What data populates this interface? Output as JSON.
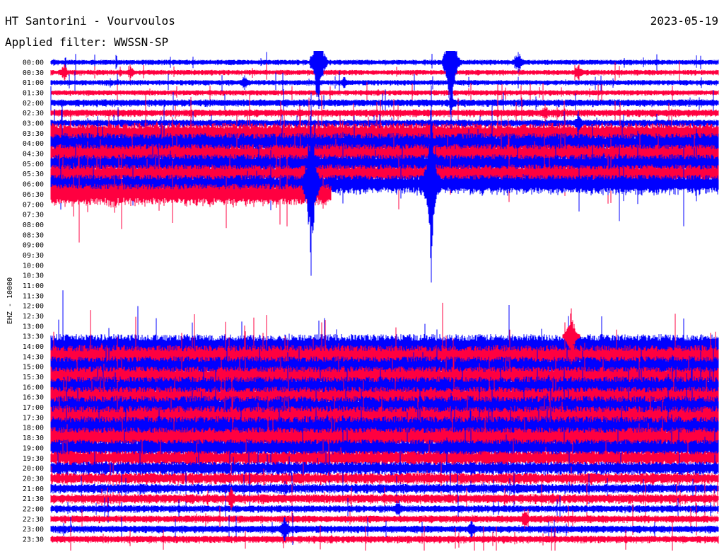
{
  "header": {
    "station": "HT Santorini - Vourvoulos",
    "date": "2023-05-19",
    "filter": "Applied filter: WWSSN-SP"
  },
  "chart_data": {
    "type": "helicorder",
    "ylabel": "EHZ - 10000",
    "trace_colors": [
      "#0000ff",
      "#ff0040"
    ],
    "rows": [
      {
        "time": "00:00",
        "level": 2,
        "gap_from": null
      },
      {
        "time": "00:30",
        "level": 2,
        "gap_from": null
      },
      {
        "time": "01:00",
        "level": 2,
        "gap_from": null
      },
      {
        "time": "01:30",
        "level": 2,
        "gap_from": null
      },
      {
        "time": "02:00",
        "level": 3,
        "gap_from": null
      },
      {
        "time": "02:30",
        "level": 3,
        "gap_from": null
      },
      {
        "time": "03:00",
        "level": 3,
        "gap_from": null
      },
      {
        "time": "03:30",
        "level": 10,
        "gap_from": null
      },
      {
        "time": "04:00",
        "level": 10,
        "gap_from": null
      },
      {
        "time": "04:30",
        "level": 9,
        "gap_from": null
      },
      {
        "time": "05:00",
        "level": 9,
        "gap_from": null
      },
      {
        "time": "05:30",
        "level": 9,
        "gap_from": null
      },
      {
        "time": "06:00",
        "level": 9,
        "gap_from": null
      },
      {
        "time": "06:30",
        "level": 10,
        "gap_from": 0.42
      },
      {
        "time": "07:00",
        "level": 0,
        "gap_from": 0
      },
      {
        "time": "07:30",
        "level": 0,
        "gap_from": 0
      },
      {
        "time": "08:00",
        "level": 0,
        "gap_from": 0
      },
      {
        "time": "08:30",
        "level": 0,
        "gap_from": 0
      },
      {
        "time": "09:00",
        "level": 0,
        "gap_from": 0
      },
      {
        "time": "09:30",
        "level": 0,
        "gap_from": 0
      },
      {
        "time": "10:00",
        "level": 0,
        "gap_from": 0
      },
      {
        "time": "10:30",
        "level": 0,
        "gap_from": 0
      },
      {
        "time": "11:00",
        "level": 0,
        "gap_from": 0
      },
      {
        "time": "11:30",
        "level": 0,
        "gap_from": 0
      },
      {
        "time": "12:00",
        "level": 0,
        "gap_from": 0
      },
      {
        "time": "12:30",
        "level": 0,
        "gap_from": 0
      },
      {
        "time": "13:00",
        "level": 0,
        "gap_from": 0
      },
      {
        "time": "13:30",
        "level": 0,
        "gap_from": 0
      },
      {
        "time": "14:00",
        "level": 12,
        "gap_from": null
      },
      {
        "time": "14:30",
        "level": 11,
        "gap_from": null
      },
      {
        "time": "15:00",
        "level": 10,
        "gap_from": null
      },
      {
        "time": "15:30",
        "level": 10,
        "gap_from": null
      },
      {
        "time": "16:00",
        "level": 10,
        "gap_from": null
      },
      {
        "time": "16:30",
        "level": 10,
        "gap_from": null
      },
      {
        "time": "17:00",
        "level": 11,
        "gap_from": null
      },
      {
        "time": "17:30",
        "level": 11,
        "gap_from": null
      },
      {
        "time": "18:00",
        "level": 11,
        "gap_from": null
      },
      {
        "time": "18:30",
        "level": 10,
        "gap_from": null
      },
      {
        "time": "19:00",
        "level": 8,
        "gap_from": null
      },
      {
        "time": "19:30",
        "level": 7,
        "gap_from": null
      },
      {
        "time": "20:00",
        "level": 6,
        "gap_from": null
      },
      {
        "time": "20:30",
        "level": 5,
        "gap_from": null
      },
      {
        "time": "21:00",
        "level": 4,
        "gap_from": null
      },
      {
        "time": "21:30",
        "level": 4,
        "gap_from": null
      },
      {
        "time": "22:00",
        "level": 3,
        "gap_from": null
      },
      {
        "time": "22:30",
        "level": 3,
        "gap_from": null
      },
      {
        "time": "23:00",
        "level": 3,
        "gap_from": null
      },
      {
        "time": "23:30",
        "level": 3,
        "gap_from": null
      }
    ],
    "events": [
      {
        "time": "00:00",
        "at": 0.4,
        "amplitude": 85
      },
      {
        "time": "00:00",
        "at": 0.6,
        "amplitude": 95
      },
      {
        "time": "00:00",
        "at": 0.7,
        "amplitude": 18
      },
      {
        "time": "00:30",
        "at": 0.02,
        "amplitude": 14
      },
      {
        "time": "00:30",
        "at": 0.79,
        "amplitude": 14
      },
      {
        "time": "00:30",
        "at": 0.12,
        "amplitude": 10
      },
      {
        "time": "01:00",
        "at": 0.29,
        "amplitude": 12
      },
      {
        "time": "01:00",
        "at": 0.44,
        "amplitude": 10
      },
      {
        "time": "02:00",
        "at": 0.6,
        "amplitude": 12
      },
      {
        "time": "02:30",
        "at": 0.74,
        "amplitude": 14
      },
      {
        "time": "03:00",
        "at": 0.79,
        "amplitude": 18
      },
      {
        "time": "06:00",
        "at": 0.39,
        "amplitude": 135
      },
      {
        "time": "06:00",
        "at": 0.57,
        "amplitude": 150
      },
      {
        "time": "13:30",
        "at": 0.78,
        "amplitude": 40
      },
      {
        "time": "21:30",
        "at": 0.27,
        "amplitude": 18
      },
      {
        "time": "22:00",
        "at": 0.52,
        "amplitude": 16
      },
      {
        "time": "22:30",
        "at": 0.71,
        "amplitude": 18
      },
      {
        "time": "23:00",
        "at": 0.35,
        "amplitude": 22
      },
      {
        "time": "23:00",
        "at": 0.63,
        "amplitude": 14
      }
    ]
  }
}
